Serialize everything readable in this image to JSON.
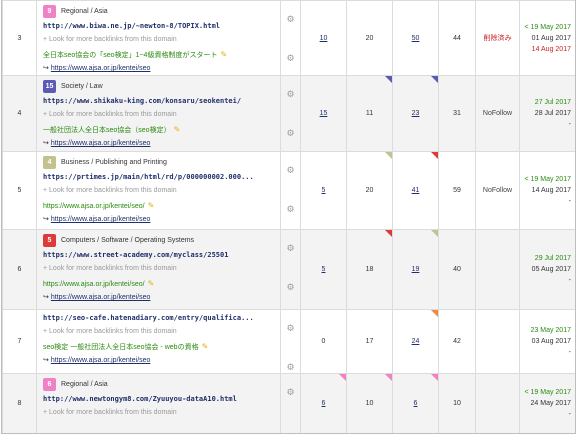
{
  "colors": {
    "pink": "#ee82c5",
    "purple": "#5b5bb5",
    "olive": "#c1c28e",
    "red": "#dd3b3b",
    "orange": "#f1893b",
    "green_text": "#2a8a0f",
    "red_text": "#cc2222"
  },
  "more_text": "+ Look for more backlinks from this domain",
  "arrow": "↪",
  "rows": [
    {
      "index": "3",
      "category": {
        "badge": "9",
        "badge_color": "pink",
        "name": "Regional / Asia"
      },
      "url": "http://www.biwa.ne.jp/~newton-8/TOPIX.html",
      "anchor": "全日本seo協会の「seo検定」1~4級資格制度がスタート",
      "target": "https://www.ajsa.or.jp/kentei/seo",
      "c1": "10",
      "c1_link": true,
      "c1_flag": "",
      "c2": "20",
      "c2_flag": "",
      "c3": "50",
      "c3_link": true,
      "c3_flag": "",
      "c4": "44",
      "status": "削除済み",
      "status_color": "red",
      "dates": [
        {
          "text": "< 19 May 2017",
          "color": "g"
        },
        {
          "text": "01 Aug 2017",
          "color": "k"
        },
        {
          "text": "14 Aug 2017",
          "color": "r"
        }
      ]
    },
    {
      "index": "4",
      "category": {
        "badge": "15",
        "badge_color": "purple",
        "name": "Society / Law"
      },
      "url": "https://www.shikaku-king.com/konsaru/seokentei/",
      "anchor": "一般社団法人全日本seo協会（seo検定）",
      "target": "https://www.ajsa.or.jp/kentei/seo",
      "c1": "15",
      "c1_link": true,
      "c1_flag": "",
      "c2": "11",
      "c2_flag": "purple",
      "c3": "23",
      "c3_link": true,
      "c3_flag": "purple",
      "c4": "31",
      "status": "NoFollow",
      "status_color": "",
      "dates": [
        {
          "text": "27 Jul 2017",
          "color": "g"
        },
        {
          "text": "28 Jul 2017",
          "color": "k"
        },
        {
          "text": "-",
          "color": "k"
        }
      ]
    },
    {
      "index": "5",
      "category": {
        "badge": "4",
        "badge_color": "olive",
        "name": "Business / Publishing and Printing"
      },
      "url": "https://prtimes.jp/main/html/rd/p/000000002.000...",
      "anchor": "https://www.ajsa.or.jp/kentei/seo/",
      "target": "https://www.ajsa.or.jp/kentei/seo",
      "c1": "5",
      "c1_link": true,
      "c1_flag": "",
      "c2": "20",
      "c2_flag": "olive",
      "c3": "41",
      "c3_link": true,
      "c3_flag": "red",
      "c4": "59",
      "status": "NoFollow",
      "status_color": "",
      "dates": [
        {
          "text": "< 19 May 2017",
          "color": "g"
        },
        {
          "text": "14 Aug 2017",
          "color": "k"
        },
        {
          "text": "-",
          "color": "k"
        }
      ]
    },
    {
      "index": "6",
      "category": {
        "badge": "5",
        "badge_color": "red",
        "name": "Computers / Software / Operating Systems"
      },
      "url": "https://www.street-academy.com/myclass/25501",
      "anchor": "https://www.ajsa.or.jp/kentei/seo/",
      "target": "https://www.ajsa.or.jp/kentei/seo",
      "c1": "5",
      "c1_link": true,
      "c1_flag": "",
      "c2": "18",
      "c2_flag": "red",
      "c3": "19",
      "c3_link": true,
      "c3_flag": "olive",
      "c4": "40",
      "status": "",
      "status_color": "",
      "dates": [
        {
          "text": "29 Jul 2017",
          "color": "g"
        },
        {
          "text": "05 Aug 2017",
          "color": "k"
        },
        {
          "text": "-",
          "color": "k"
        }
      ]
    },
    {
      "index": "7",
      "category": null,
      "url": "http://seo-cafe.hatenadiary.com/entry/qualifica...",
      "anchor": "seo検定 一般社団法人全日本seo協会 - webの資格",
      "target": "https://www.ajsa.or.jp/kentei/seo",
      "c1": "0",
      "c1_link": false,
      "c1_flag": "",
      "c2": "17",
      "c2_flag": "",
      "c3": "24",
      "c3_link": true,
      "c3_flag": "orange",
      "c4": "42",
      "status": "",
      "status_color": "",
      "dates": [
        {
          "text": "23 May 2017",
          "color": "g"
        },
        {
          "text": "03 Aug 2017",
          "color": "k"
        },
        {
          "text": "-",
          "color": "k"
        }
      ]
    },
    {
      "index": "8",
      "category": {
        "badge": "6",
        "badge_color": "pink",
        "name": "Regional / Asia"
      },
      "url": "http://www.newtongym8.com/Zyuuyou-dataA10.html",
      "anchor": "",
      "target": "",
      "c1": "6",
      "c1_link": true,
      "c1_flag": "pink",
      "c2": "10",
      "c2_flag": "pink",
      "c3": "6",
      "c3_link": true,
      "c3_flag": "pink",
      "c4": "10",
      "status": "",
      "status_color": "",
      "dates": [
        {
          "text": "< 19 May 2017",
          "color": "g"
        },
        {
          "text": "24 May 2017",
          "color": "k"
        },
        {
          "text": "-",
          "color": "k"
        }
      ]
    }
  ]
}
